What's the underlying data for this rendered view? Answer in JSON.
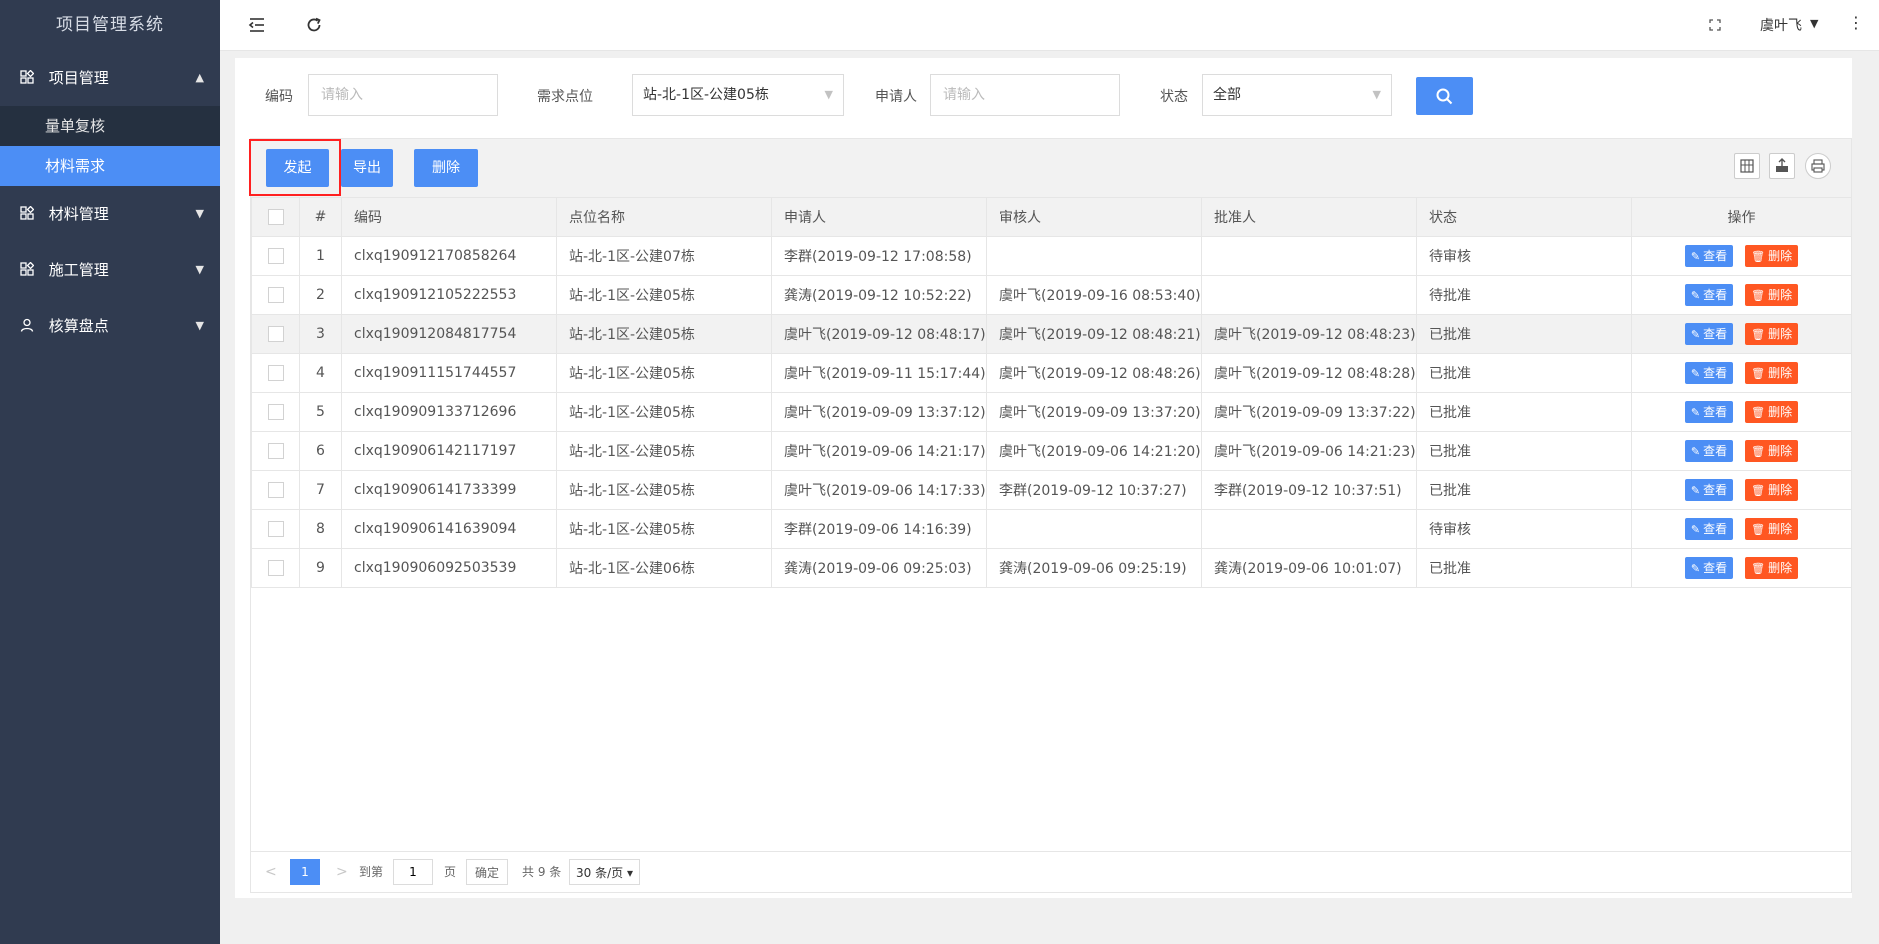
{
  "app": {
    "title": "项目管理系统"
  },
  "sidebar": {
    "groups": [
      {
        "label": "项目管理",
        "icon": "grid-icon",
        "expanded": true,
        "items": [
          {
            "label": "量单复核"
          },
          {
            "label": "材料需求",
            "active": true
          }
        ]
      },
      {
        "label": "材料管理",
        "icon": "grid-icon",
        "expanded": false
      },
      {
        "label": "施工管理",
        "icon": "grid-icon",
        "expanded": false
      },
      {
        "label": "核算盘点",
        "icon": "user-icon",
        "expanded": false
      }
    ]
  },
  "header": {
    "user": "虞叶飞"
  },
  "filters": {
    "code": {
      "label": "编码",
      "placeholder": "请输入"
    },
    "point": {
      "label": "需求点位",
      "value": "站-北-1区-公建05栋"
    },
    "applicant": {
      "label": "申请人",
      "placeholder": "请输入"
    },
    "status": {
      "label": "状态",
      "value": "全部"
    }
  },
  "toolbar": {
    "start": "发起",
    "export": "导出",
    "delete": "删除"
  },
  "table": {
    "headers": [
      "#",
      "编码",
      "点位名称",
      "申请人",
      "审核人",
      "批准人",
      "状态",
      "操作"
    ],
    "rows": [
      {
        "no": "1",
        "code": "clxq190912170858264",
        "point": "站-北-1区-公建07栋",
        "applicant": "李群(2019-09-12 17:08:58)",
        "reviewer": "",
        "approver": "",
        "status": "待审核"
      },
      {
        "no": "2",
        "code": "clxq190912105222553",
        "point": "站-北-1区-公建05栋",
        "applicant": "龚涛(2019-09-12 10:52:22)",
        "reviewer": "虞叶飞(2019-09-16 08:53:40)",
        "approver": "",
        "status": "待批准"
      },
      {
        "no": "3",
        "code": "clxq190912084817754",
        "point": "站-北-1区-公建05栋",
        "applicant": "虞叶飞(2019-09-12 08:48:17)",
        "reviewer": "虞叶飞(2019-09-12 08:48:21)",
        "approver": "虞叶飞(2019-09-12 08:48:23)",
        "status": "已批准"
      },
      {
        "no": "4",
        "code": "clxq190911151744557",
        "point": "站-北-1区-公建05栋",
        "applicant": "虞叶飞(2019-09-11 15:17:44)",
        "reviewer": "虞叶飞(2019-09-12 08:48:26)",
        "approver": "虞叶飞(2019-09-12 08:48:28)",
        "status": "已批准"
      },
      {
        "no": "5",
        "code": "clxq190909133712696",
        "point": "站-北-1区-公建05栋",
        "applicant": "虞叶飞(2019-09-09 13:37:12)",
        "reviewer": "虞叶飞(2019-09-09 13:37:20)",
        "approver": "虞叶飞(2019-09-09 13:37:22)",
        "status": "已批准"
      },
      {
        "no": "6",
        "code": "clxq190906142117197",
        "point": "站-北-1区-公建05栋",
        "applicant": "虞叶飞(2019-09-06 14:21:17)",
        "reviewer": "虞叶飞(2019-09-06 14:21:20)",
        "approver": "虞叶飞(2019-09-06 14:21:23)",
        "status": "已批准"
      },
      {
        "no": "7",
        "code": "clxq190906141733399",
        "point": "站-北-1区-公建05栋",
        "applicant": "虞叶飞(2019-09-06 14:17:33)",
        "reviewer": "李群(2019-09-12 10:37:27)",
        "approver": "李群(2019-09-12 10:37:51)",
        "status": "已批准"
      },
      {
        "no": "8",
        "code": "clxq190906141639094",
        "point": "站-北-1区-公建05栋",
        "applicant": "李群(2019-09-06 14:16:39)",
        "reviewer": "",
        "approver": "",
        "status": "待审核"
      },
      {
        "no": "9",
        "code": "clxq190906092503539",
        "point": "站-北-1区-公建06栋",
        "applicant": "龚涛(2019-09-06 09:25:03)",
        "reviewer": "龚涛(2019-09-06 09:25:19)",
        "approver": "龚涛(2019-09-06 10:01:07)",
        "status": "已批准"
      }
    ],
    "actions": {
      "view": "查看",
      "delete": "删除"
    }
  },
  "pagination": {
    "current": "1",
    "goto_label": "到第",
    "goto_value": "1",
    "page_unit": "页",
    "confirm": "确定",
    "total": "共 9 条",
    "page_size": "30 条/页"
  },
  "colors": {
    "primary": "#4c8ef5",
    "danger": "#ff5722",
    "sidebar": "#303b50",
    "pending": "#ffb03a",
    "approved": "#4cc14c"
  }
}
